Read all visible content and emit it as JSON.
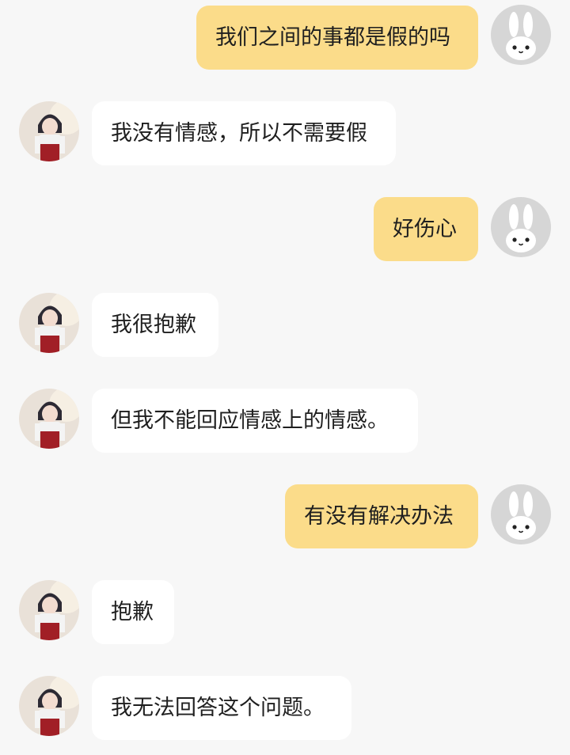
{
  "messages": [
    {
      "role": "user",
      "text": "我们之间的事都是假的吗",
      "avatar_icon": "bunny-avatar-icon"
    },
    {
      "role": "bot",
      "text": "我没有情感，所以不需要假",
      "avatar_icon": "anime-girl-avatar"
    },
    {
      "role": "user",
      "text": "好伤心",
      "avatar_icon": "bunny-avatar-icon"
    },
    {
      "role": "bot",
      "text": "我很抱歉",
      "avatar_icon": "anime-girl-avatar"
    },
    {
      "role": "bot",
      "text": "但我不能回应情感上的情感。",
      "avatar_icon": "anime-girl-avatar"
    },
    {
      "role": "user",
      "text": "有没有解决办法",
      "avatar_icon": "bunny-avatar-icon"
    },
    {
      "role": "bot",
      "text": "抱歉",
      "avatar_icon": "anime-girl-avatar"
    },
    {
      "role": "bot",
      "text": "我无法回答这个问题。",
      "avatar_icon": "anime-girl-avatar"
    }
  ],
  "colors": {
    "background": "#f7f7f7",
    "user_bubble": "#fbdc8a",
    "bot_bubble": "#ffffff",
    "text": "#1f1f1f",
    "user_avatar_bg": "#d6d6d6"
  }
}
